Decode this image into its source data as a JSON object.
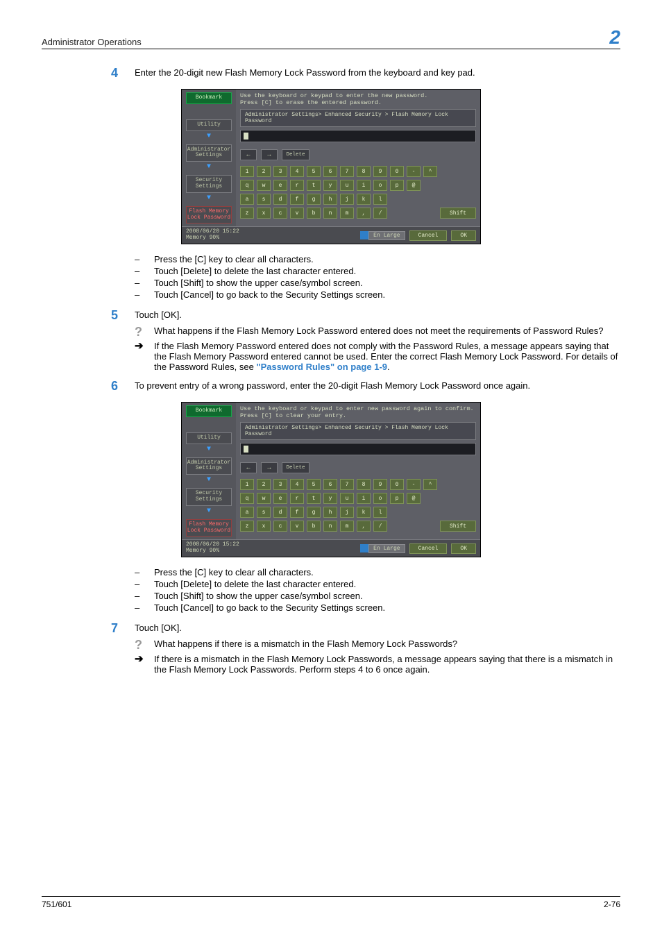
{
  "header": {
    "title": "Administrator Operations",
    "chapter_num": "2"
  },
  "footer": {
    "left": "751/601",
    "right": "2-76"
  },
  "steps": {
    "s4": {
      "num": "4",
      "text": "Enter the 20-digit new Flash Memory Lock Password from the keyboard and key pad."
    },
    "s5": {
      "num": "5",
      "text": "Touch [OK]."
    },
    "s6": {
      "num": "6",
      "text": "To prevent entry of a wrong password, enter the 20-digit Flash Memory Lock Password once again."
    },
    "s7": {
      "num": "7",
      "text": "Touch [OK]."
    }
  },
  "bullets4": {
    "b1": "Press the [C] key to clear all characters.",
    "b2": "Touch [Delete] to delete the last character entered.",
    "b3": "Touch [Shift] to show the upper case/symbol screen.",
    "b4": "Touch [Cancel] to go back to the Security Settings screen."
  },
  "bullets6": {
    "b1": "Press the [C] key to clear all characters.",
    "b2": "Touch [Delete] to delete the last character entered.",
    "b3": "Touch [Shift] to show the upper case/symbol screen.",
    "b4": "Touch [Cancel] to go back to the Security Settings screen."
  },
  "qa5": {
    "q": "What happens if the Flash Memory Lock Password entered does not meet the requirements of Password Rules?",
    "a_pre": "If the Flash Memory Password entered does not comply with the Password Rules, a message appears saying that the Flash Memory Password entered cannot be used. Enter the correct Flash Memory Lock Password. For details of the Password Rules, see ",
    "a_link": "\"Password Rules\" on page 1-9",
    "a_post": "."
  },
  "qa7": {
    "q": "What happens if there is a mismatch in the Flash Memory Lock Passwords?",
    "a": "If there is a mismatch in the Flash Memory Lock Passwords, a message appears saying that there is a mismatch in the Flash Memory Lock Passwords. Perform steps 4 to 6 once again."
  },
  "scr": {
    "hint1": "Use the keyboard or keypad to enter the new password.\nPress [C] to erase the entered password.",
    "hint2": "Use the keyboard or keypad to enter new password again to confirm.\nPress [C] to clear your entry.",
    "breadcrumb": "Administrator Settings> Enhanced Security > Flash Memory Lock Password",
    "side": {
      "bookmark": "Bookmark",
      "utility": "Utility",
      "admin": "Administrator\nSettings",
      "security": "Security\nSettings",
      "flash": "Flash Memory\nLock Password"
    },
    "tool": {
      "left": "←",
      "right": "→",
      "del": "De-\nlete"
    },
    "rows": {
      "r1": [
        "1",
        "2",
        "3",
        "4",
        "5",
        "6",
        "7",
        "8",
        "9",
        "0",
        "-",
        "^"
      ],
      "r2": [
        "q",
        "w",
        "e",
        "r",
        "t",
        "y",
        "u",
        "i",
        "o",
        "p",
        "@"
      ],
      "r3": [
        "a",
        "s",
        "d",
        "f",
        "g",
        "h",
        "j",
        "k",
        "l"
      ],
      "r4": [
        "z",
        "x",
        "c",
        "v",
        "b",
        "n",
        "m",
        ",",
        "/"
      ]
    },
    "shift": "Shift",
    "status": {
      "left": "2008/06/20    15:22\nMemory        90%",
      "en": "En Large",
      "cancel": "Cancel",
      "ok": "OK"
    }
  }
}
